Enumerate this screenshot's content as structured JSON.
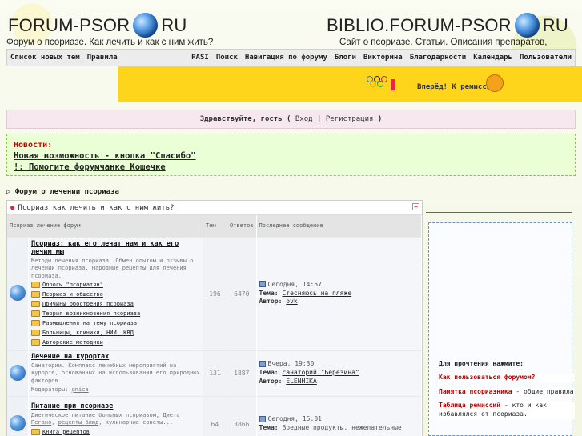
{
  "header": {
    "left_logo_prefix": "FORUM-PSOR",
    "left_logo_suffix": "RU",
    "left_tagline": "Форум о псориазе. Как лечить и как с ним жить?",
    "right_logo_prefix": "BIBLIO.FORUM-PSOR",
    "right_logo_suffix": "RU",
    "right_tagline": "Сайт о псориазе. Статьи. Описания препаратов, методик."
  },
  "nav": {
    "left": [
      "Список новых тем",
      "Правила"
    ],
    "right": [
      "PASI",
      "Поиск",
      "Навигация по форуму",
      "Блоги",
      "Викторина",
      "Благодарности",
      "Календарь",
      "Пользователи"
    ]
  },
  "banner": {
    "motto": "Вперёд! К ремиссии!"
  },
  "greeting": {
    "text": "Здравствуйте, гость (",
    "login": "Вход",
    "sep": "|",
    "register": "Регистрация",
    "close": ")"
  },
  "news": {
    "heading": "Новости:",
    "items": [
      "Новая возможность - кнопка \"Спасибо\"",
      "!: Помогите форумчанке Кошечке"
    ]
  },
  "breadcrumb": "Форум о лечении псориаза",
  "category": {
    "title": "Псориаз как лечить и как с ним жить?",
    "collapse": "−"
  },
  "columns": {
    "forum": "Псориаз лечение форум",
    "topics": "Тем",
    "replies": "Ответов",
    "last": "Последнее сообщение"
  },
  "forums": [
    {
      "title": "Псориаз: как его лечат нам и как его лечим мы",
      "desc": "Методы лечения псориаза. Обмен опытом и отзывы о лечении псориаза. Народные рецепты для лечения псориаза.",
      "subforums": [
        "Опросы \"псориатян\"",
        "Псориаз и общество",
        "Причины обострения псориаза",
        "Теория возникновения псориаза",
        "Размышления на тему псориаза",
        "Больницы, клиники, НИИ, КВД",
        "Авторские методики"
      ],
      "topics": "196",
      "replies": "6470",
      "last_date": "Сегодня, 14:57",
      "last_topic_label": "Тема:",
      "last_topic": "Стесняюсь на пляже",
      "last_author_label": "Автор:",
      "last_author": "ovk"
    },
    {
      "title": "Лечение на курортах",
      "desc": "Санатории. Комплекс лечебных мероприятий на курорте, основанных на использовании его природных факторов.",
      "moderator_label": "Модераторы:",
      "moderator": "gnica",
      "subforums": [],
      "topics": "131",
      "replies": "1887",
      "last_date": "Вчера, 19:30",
      "last_topic_label": "Тема:",
      "last_topic": "санаторий \"Березина\"",
      "last_author_label": "Автор:",
      "last_author": "ELENHIKA"
    },
    {
      "title": "Питание при псориазе",
      "desc_prefix": "Диетическое питание больных псориазом,",
      "desc_link1": "Диета Пегано",
      "desc_link2": "рецепты блюд",
      "desc_suffix": ", кулинарные советы...",
      "subforums": [
        "Книга рецептов",
        "Система питания по Пегано"
      ],
      "topics": "64",
      "replies": "3866",
      "last_date": "Сегодня, 15:01",
      "last_topic_label": "Тема:",
      "last_topic": "Вредные продукты. нежелательные"
    }
  ],
  "sidebar": {
    "heading": "Для прочтения нажмите:",
    "link1": "Как пользоваться форумом?",
    "item2_title": "Памятка псориазника",
    "item2_rest": " - общие правила",
    "item3_title": "Таблица ремиссий",
    "item3_rest": " - кто и как избавлялся от псориаза."
  }
}
